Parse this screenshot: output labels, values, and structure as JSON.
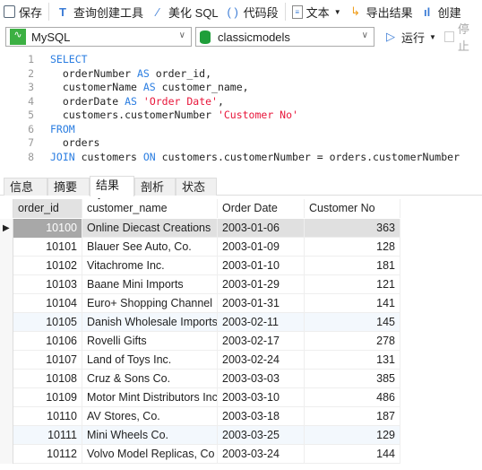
{
  "toolbar": {
    "save": "保存",
    "query_builder": "查询创建工具",
    "beautify": "美化 SQL",
    "snippet": "代码段",
    "text": "文本",
    "export": "导出结果",
    "create": "创建"
  },
  "connection": {
    "type": "MySQL",
    "database": "classicmodels",
    "run": "运行",
    "stop": "停止"
  },
  "editor": {
    "lines": [
      [
        {
          "t": "SELECT",
          "k": "kw"
        }
      ],
      [
        {
          "t": "  orderNumber "
        },
        {
          "t": "AS",
          "k": "kw"
        },
        {
          "t": " order_id,"
        }
      ],
      [
        {
          "t": "  customerName "
        },
        {
          "t": "AS",
          "k": "kw"
        },
        {
          "t": " customer_name,"
        }
      ],
      [
        {
          "t": "  orderDate "
        },
        {
          "t": "AS",
          "k": "kw"
        },
        {
          "t": " "
        },
        {
          "t": "'Order Date'",
          "k": "str"
        },
        {
          "t": ","
        }
      ],
      [
        {
          "t": "  customers.customerNumber "
        },
        {
          "t": "'Customer No'",
          "k": "str"
        }
      ],
      [
        {
          "t": "FROM",
          "k": "kw"
        }
      ],
      [
        {
          "t": "  orders"
        }
      ],
      [
        {
          "t": "JOIN",
          "k": "kw"
        },
        {
          "t": " customers "
        },
        {
          "t": "ON",
          "k": "kw"
        },
        {
          "t": " customers.customerNumber = orders.customerNumber"
        }
      ]
    ]
  },
  "tabs": [
    "信息",
    "摘要",
    "结果 1",
    "剖析",
    "状态"
  ],
  "active_tab": "结果 1",
  "table": {
    "columns": [
      "order_id",
      "customer_name",
      "Order Date",
      "Customer No"
    ],
    "rows": [
      [
        "10100",
        "Online Diecast Creations",
        "2003-01-06",
        "363"
      ],
      [
        "10101",
        "Blauer See Auto, Co.",
        "2003-01-09",
        "128"
      ],
      [
        "10102",
        "Vitachrome Inc.",
        "2003-01-10",
        "181"
      ],
      [
        "10103",
        "Baane Mini Imports",
        "2003-01-29",
        "121"
      ],
      [
        "10104",
        "Euro+ Shopping Channel",
        "2003-01-31",
        "141"
      ],
      [
        "10105",
        "Danish Wholesale Imports",
        "2003-02-11",
        "145"
      ],
      [
        "10106",
        "Rovelli Gifts",
        "2003-02-17",
        "278"
      ],
      [
        "10107",
        "Land of Toys Inc.",
        "2003-02-24",
        "131"
      ],
      [
        "10108",
        "Cruz & Sons Co.",
        "2003-03-03",
        "385"
      ],
      [
        "10109",
        "Motor Mint Distributors Inc.",
        "2003-03-10",
        "486"
      ],
      [
        "10110",
        "AV Stores, Co.",
        "2003-03-18",
        "187"
      ],
      [
        "10111",
        "Mini Wheels Co.",
        "2003-03-25",
        "129"
      ],
      [
        "10112",
        "Volvo Model Replicas, Co",
        "2003-03-24",
        "144"
      ]
    ],
    "selected_row": 0
  },
  "colors": {
    "keyword": "#2a7de1",
    "string": "#e8163a",
    "selected_row": "#e0e0e0",
    "selected_cell": "#a8a8a8"
  }
}
